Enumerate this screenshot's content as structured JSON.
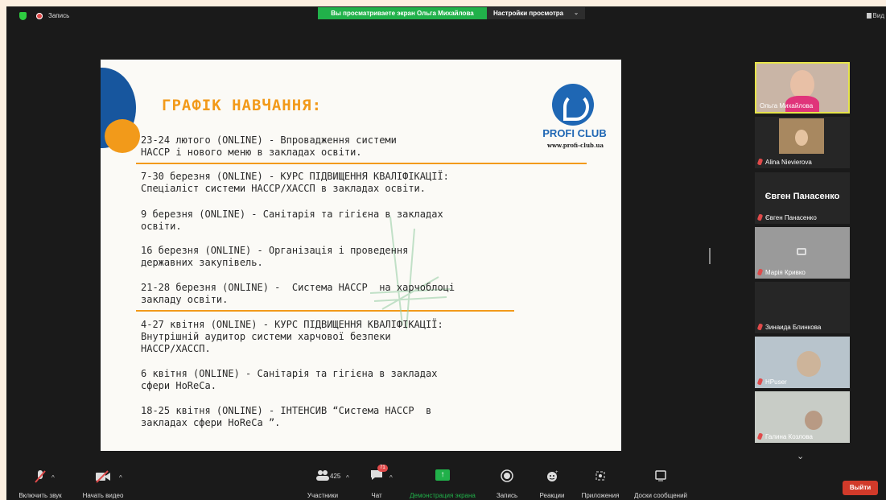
{
  "topbar": {
    "record_label": "Запись",
    "sharing_banner": "Вы просматриваете экран Ольга Михайлова",
    "view_settings": "Настройки просмотра",
    "view_button": "Вид"
  },
  "slide": {
    "title": "ГРАФІК НАВЧАННЯ:",
    "logo_text": "PROFI CLUB",
    "logo_url": "www.profi-club.ua",
    "items": [
      "23-24 лютого (ONLINE) - Впровадження системи\nНАССР і нового меню в закладах освіти.",
      "7-30 березня (ONLINE) - КУРС ПІДВИЩЕННЯ КВАЛІФІКАЦІЇ:\nСпеціаліст системи НАССР/ХАССП в закладах освіти.",
      "9 березня (ONLINE) - Санітарія та гігієна в закладах\nосвіти.",
      "16 березня (ONLINE) - Організація і проведення\nдержавних закупівель.",
      "21-28 березня (ONLINE) -  Система НАССР  на харчоблоці\nзакладу освіти.",
      "4-27 квітня (ONLINE) - КУРС ПІДВИЩЕННЯ КВАЛІФІКАЦІЇ:\nВнутрішній аудитор системи харчової безпеки\nНАССР/ХАССП.",
      "6 квітня (ONLINE) - Санітарія та гігієна в закладах\nсфери HoReCa.",
      "18-25 квітня (ONLINE) - ІНТЕНСИВ “Система НАССР  в\nзакладах сфери HoReCa ”."
    ]
  },
  "participants": [
    {
      "name": "Ольга Михайлова",
      "muted": false,
      "active": true
    },
    {
      "name": "Alina Nievierova",
      "muted": true
    },
    {
      "name": "Євген Панасенко",
      "big_name": "Євген Панасенко",
      "muted": true
    },
    {
      "name": "Марія Кривко",
      "muted": true
    },
    {
      "name": "Зинаида Блинкова",
      "muted": true
    },
    {
      "name": "HPuser",
      "muted": true
    },
    {
      "name": "Галина Козлова",
      "muted": true
    }
  ],
  "toolbar": {
    "unmute": "Включить звук",
    "start_video": "Начать видео",
    "participants": "Участники",
    "participants_count": "425",
    "chat": "Чат",
    "chat_badge": "71",
    "share": "Демонстрация экрана",
    "record": "Запись",
    "reactions": "Реакции",
    "apps": "Приложения",
    "whiteboards": "Доски сообщений",
    "leave": "Выйти"
  },
  "colors": {
    "share_green": "#21b14a",
    "slide_orange": "#f29a1a",
    "slide_blue": "#17569e",
    "leave_red": "#d13a2a",
    "active_border": "#e6e44a"
  }
}
